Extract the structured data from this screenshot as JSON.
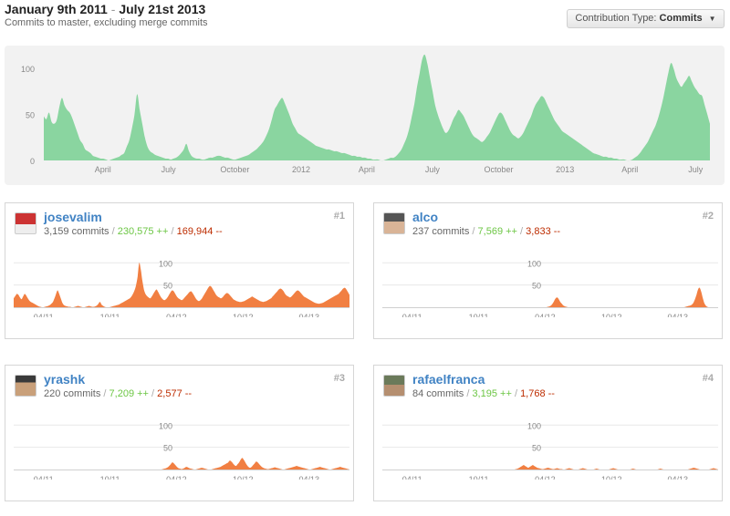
{
  "header": {
    "date_start": "January 9th 2011",
    "separator": "-",
    "date_end": "July 21st 2013",
    "subtitle": "Commits to master, excluding merge commits"
  },
  "contribution_type": {
    "label": "Contribution Type:",
    "value": "Commits",
    "icon": "caret-down-icon"
  },
  "colors": {
    "overview_fill": "#8ad5a0",
    "contributor_fill": "#f17f42"
  },
  "contributors": [
    {
      "rank": "#1",
      "name": "josevalim",
      "commits": "3,159 commits",
      "additions": "230,575 ++",
      "deletions": "169,944 --"
    },
    {
      "rank": "#2",
      "name": "alco",
      "commits": "237 commits",
      "additions": "7,569 ++",
      "deletions": "3,833 --"
    },
    {
      "rank": "#3",
      "name": "yrashk",
      "commits": "220 commits",
      "additions": "7,209 ++",
      "deletions": "2,577 --"
    },
    {
      "rank": "#4",
      "name": "rafaelfranca",
      "commits": "84 commits",
      "additions": "3,195 ++",
      "deletions": "1,768 --"
    }
  ],
  "chart_data": [
    {
      "type": "area",
      "series": "overview",
      "x_start": "2011-01-09",
      "x_end": "2013-07-21",
      "step_days": 14,
      "y_ticks": [
        0,
        50,
        100
      ],
      "ylim": [
        0,
        115
      ],
      "x_ticks": [
        {
          "label": "April",
          "date": "2011-04-01"
        },
        {
          "label": "July",
          "date": "2011-07-01"
        },
        {
          "label": "October",
          "date": "2011-10-01"
        },
        {
          "label": "2012",
          "date": "2012-01-01"
        },
        {
          "label": "April",
          "date": "2012-04-01"
        },
        {
          "label": "July",
          "date": "2012-07-01"
        },
        {
          "label": "October",
          "date": "2012-10-01"
        },
        {
          "label": "2013",
          "date": "2013-01-01"
        },
        {
          "label": "April",
          "date": "2013-04-01"
        },
        {
          "label": "July",
          "date": "2013-07-01"
        }
      ],
      "values": [
        48,
        45,
        52,
        42,
        40,
        44,
        58,
        68,
        60,
        55,
        52,
        46,
        38,
        30,
        22,
        18,
        12,
        10,
        8,
        5,
        4,
        3,
        2,
        2,
        1,
        0,
        1,
        2,
        3,
        4,
        6,
        8,
        15,
        22,
        35,
        50,
        72,
        55,
        40,
        25,
        15,
        10,
        8,
        6,
        5,
        4,
        3,
        2,
        2,
        1,
        2,
        3,
        5,
        8,
        12,
        18,
        10,
        5,
        3,
        2,
        2,
        1,
        1,
        2,
        3,
        3,
        4,
        5,
        5,
        4,
        3,
        3,
        2,
        1,
        1,
        2,
        3,
        4,
        5,
        6,
        8,
        10,
        12,
        15,
        18,
        22,
        28,
        35,
        45,
        55,
        60,
        65,
        68,
        62,
        55,
        48,
        40,
        35,
        30,
        28,
        26,
        24,
        22,
        20,
        18,
        16,
        15,
        14,
        13,
        12,
        12,
        11,
        10,
        10,
        9,
        8,
        8,
        7,
        6,
        5,
        5,
        4,
        4,
        3,
        3,
        2,
        2,
        1,
        1,
        1,
        0,
        0,
        1,
        2,
        3,
        3,
        5,
        8,
        12,
        18,
        25,
        35,
        48,
        62,
        80,
        95,
        110,
        115,
        105,
        90,
        75,
        60,
        50,
        42,
        35,
        30,
        32,
        38,
        45,
        50,
        55,
        52,
        48,
        42,
        36,
        30,
        26,
        24,
        22,
        20,
        22,
        26,
        30,
        36,
        42,
        48,
        52,
        50,
        44,
        38,
        32,
        28,
        26,
        24,
        26,
        30,
        36,
        42,
        48,
        56,
        62,
        66,
        70,
        68,
        62,
        56,
        50,
        44,
        40,
        36,
        32,
        30,
        28,
        26,
        24,
        22,
        20,
        18,
        16,
        14,
        12,
        10,
        8,
        7,
        6,
        5,
        4,
        4,
        3,
        3,
        2,
        2,
        1,
        1,
        1,
        0,
        0,
        1,
        3,
        5,
        8,
        12,
        16,
        20,
        26,
        32,
        38,
        46,
        56,
        68,
        82,
        96,
        106,
        100,
        90,
        84,
        80,
        84,
        88,
        92,
        86,
        80,
        76,
        72,
        70,
        60,
        50,
        40
      ]
    },
    {
      "type": "area",
      "series": "josevalim",
      "x_start": "2011-01-09",
      "x_end": "2013-07-21",
      "y_ticks": [
        50,
        100
      ],
      "ylim": [
        0,
        115
      ],
      "x_ticks": [
        {
          "label": "04/11",
          "date": "2011-04-01"
        },
        {
          "label": "10/11",
          "date": "2011-10-01"
        },
        {
          "label": "04/12",
          "date": "2012-04-01"
        },
        {
          "label": "10/12",
          "date": "2012-10-01"
        },
        {
          "label": "04/13",
          "date": "2013-04-01"
        }
      ],
      "values": [
        20,
        25,
        30,
        28,
        22,
        18,
        24,
        30,
        26,
        20,
        15,
        12,
        10,
        8,
        6,
        4,
        2,
        1,
        0,
        0,
        1,
        2,
        3,
        5,
        8,
        12,
        20,
        30,
        38,
        30,
        20,
        10,
        5,
        3,
        2,
        1,
        1,
        0,
        0,
        1,
        2,
        3,
        2,
        1,
        0,
        0,
        1,
        2,
        3,
        2,
        1,
        1,
        2,
        4,
        8,
        12,
        6,
        3,
        1,
        0,
        0,
        0,
        1,
        2,
        3,
        4,
        5,
        6,
        8,
        10,
        12,
        14,
        16,
        18,
        20,
        24,
        30,
        38,
        50,
        70,
        100,
        85,
        60,
        40,
        30,
        25,
        22,
        20,
        24,
        30,
        36,
        40,
        35,
        28,
        22,
        18,
        16,
        18,
        22,
        28,
        34,
        38,
        36,
        30,
        24,
        20,
        18,
        16,
        18,
        22,
        26,
        30,
        34,
        36,
        32,
        26,
        20,
        16,
        14,
        16,
        20,
        26,
        32,
        38,
        44,
        48,
        46,
        40,
        34,
        28,
        24,
        22,
        20,
        22,
        26,
        30,
        32,
        30,
        26,
        22,
        18,
        16,
        14,
        13,
        12,
        12,
        13,
        14,
        16,
        18,
        20,
        22,
        24,
        22,
        20,
        18,
        16,
        14,
        13,
        12,
        13,
        14,
        16,
        18,
        20,
        24,
        28,
        32,
        36,
        40,
        42,
        40,
        36,
        30,
        26,
        24,
        22,
        24,
        28,
        32,
        36,
        38,
        36,
        32,
        28,
        24,
        22,
        20,
        18,
        16,
        14,
        12,
        10,
        9,
        8,
        8,
        9,
        10,
        12,
        14,
        16,
        18,
        20,
        22,
        24,
        26,
        28,
        30,
        34,
        38,
        42,
        44,
        40,
        34,
        28
      ]
    },
    {
      "type": "area",
      "series": "alco",
      "x_start": "2011-01-09",
      "x_end": "2013-07-21",
      "y_ticks": [
        50,
        100
      ],
      "ylim": [
        0,
        115
      ],
      "x_ticks": [
        {
          "label": "04/11",
          "date": "2011-04-01"
        },
        {
          "label": "10/11",
          "date": "2011-10-01"
        },
        {
          "label": "04/12",
          "date": "2012-04-01"
        },
        {
          "label": "10/12",
          "date": "2012-10-01"
        },
        {
          "label": "04/13",
          "date": "2013-04-01"
        }
      ],
      "values": [
        0,
        0,
        0,
        0,
        0,
        0,
        0,
        0,
        0,
        0,
        0,
        0,
        0,
        0,
        0,
        0,
        0,
        0,
        0,
        0,
        0,
        0,
        0,
        0,
        0,
        0,
        0,
        0,
        0,
        0,
        0,
        0,
        0,
        0,
        0,
        0,
        0,
        0,
        0,
        0,
        0,
        0,
        0,
        0,
        0,
        0,
        0,
        0,
        0,
        0,
        0,
        0,
        0,
        0,
        0,
        0,
        0,
        0,
        0,
        0,
        0,
        0,
        0,
        0,
        0,
        0,
        0,
        0,
        0,
        0,
        0,
        0,
        0,
        0,
        0,
        0,
        0,
        0,
        0,
        0,
        0,
        0,
        0,
        0,
        0,
        0,
        0,
        0,
        0,
        0,
        0,
        0,
        0,
        0,
        0,
        0,
        0,
        0,
        0,
        0,
        0,
        0,
        0,
        0,
        0,
        0,
        0,
        1,
        2,
        4,
        8,
        14,
        20,
        22,
        18,
        12,
        8,
        4,
        2,
        1,
        0,
        0,
        0,
        0,
        0,
        0,
        0,
        0,
        0,
        0,
        0,
        0,
        0,
        0,
        0,
        0,
        0,
        0,
        0,
        0,
        0,
        0,
        0,
        0,
        0,
        0,
        0,
        0,
        0,
        0,
        0,
        0,
        0,
        0,
        0,
        0,
        0,
        0,
        0,
        0,
        0,
        0,
        0,
        0,
        0,
        0,
        0,
        0,
        0,
        0,
        0,
        0,
        0,
        0,
        0,
        0,
        0,
        0,
        0,
        0,
        0,
        0,
        0,
        0,
        0,
        0,
        0,
        0,
        0,
        0,
        0,
        0,
        0,
        0,
        0,
        0,
        1,
        2,
        3,
        4,
        6,
        10,
        18,
        28,
        40,
        44,
        36,
        22,
        10,
        4,
        1,
        0,
        0,
        0,
        0,
        0,
        0,
        0
      ]
    },
    {
      "type": "area",
      "series": "yrashk",
      "x_start": "2011-01-09",
      "x_end": "2013-07-21",
      "y_ticks": [
        50,
        100
      ],
      "ylim": [
        0,
        115
      ],
      "x_ticks": [
        {
          "label": "04/11",
          "date": "2011-04-01"
        },
        {
          "label": "10/11",
          "date": "2011-10-01"
        },
        {
          "label": "04/12",
          "date": "2012-04-01"
        },
        {
          "label": "10/12",
          "date": "2012-10-01"
        },
        {
          "label": "04/13",
          "date": "2013-04-01"
        }
      ],
      "values": [
        0,
        0,
        0,
        0,
        0,
        0,
        0,
        0,
        0,
        0,
        0,
        0,
        0,
        0,
        0,
        0,
        0,
        0,
        0,
        0,
        0,
        0,
        0,
        0,
        0,
        0,
        0,
        0,
        0,
        0,
        0,
        0,
        0,
        0,
        0,
        0,
        0,
        0,
        0,
        0,
        0,
        0,
        0,
        0,
        0,
        0,
        0,
        0,
        0,
        0,
        0,
        0,
        0,
        0,
        0,
        0,
        0,
        0,
        0,
        0,
        0,
        0,
        0,
        0,
        0,
        0,
        0,
        0,
        0,
        0,
        0,
        0,
        0,
        0,
        0,
        0,
        0,
        0,
        0,
        0,
        0,
        0,
        0,
        0,
        0,
        0,
        0,
        0,
        0,
        0,
        0,
        0,
        0,
        0,
        0,
        0,
        1,
        2,
        3,
        5,
        8,
        12,
        16,
        14,
        10,
        6,
        3,
        2,
        1,
        2,
        4,
        6,
        5,
        3,
        2,
        1,
        0,
        0,
        1,
        2,
        3,
        4,
        3,
        2,
        1,
        0,
        0,
        0,
        1,
        2,
        3,
        4,
        5,
        6,
        8,
        10,
        12,
        14,
        16,
        20,
        18,
        14,
        10,
        8,
        12,
        16,
        22,
        26,
        22,
        16,
        10,
        6,
        4,
        6,
        10,
        14,
        18,
        16,
        12,
        8,
        5,
        3,
        2,
        1,
        1,
        2,
        3,
        4,
        5,
        4,
        3,
        2,
        1,
        0,
        0,
        1,
        2,
        3,
        4,
        5,
        6,
        7,
        8,
        7,
        6,
        5,
        4,
        3,
        2,
        1,
        0,
        0,
        1,
        2,
        3,
        4,
        5,
        6,
        5,
        4,
        3,
        2,
        1,
        0,
        0,
        1,
        2,
        3,
        4,
        5,
        6,
        5,
        4,
        3,
        2,
        1,
        0
      ]
    },
    {
      "type": "area",
      "series": "rafaelfranca",
      "x_start": "2011-01-09",
      "x_end": "2013-07-21",
      "y_ticks": [
        50,
        100
      ],
      "ylim": [
        0,
        115
      ],
      "x_ticks": [
        {
          "label": "04/11",
          "date": "2011-04-01"
        },
        {
          "label": "10/11",
          "date": "2011-10-01"
        },
        {
          "label": "04/12",
          "date": "2012-04-01"
        },
        {
          "label": "10/12",
          "date": "2012-10-01"
        },
        {
          "label": "04/13",
          "date": "2013-04-01"
        }
      ],
      "values": [
        0,
        0,
        0,
        0,
        0,
        0,
        0,
        0,
        0,
        0,
        0,
        0,
        0,
        0,
        0,
        0,
        0,
        0,
        0,
        0,
        0,
        0,
        0,
        0,
        0,
        0,
        0,
        0,
        0,
        0,
        0,
        0,
        0,
        0,
        0,
        0,
        0,
        0,
        0,
        0,
        0,
        0,
        0,
        0,
        0,
        0,
        0,
        0,
        0,
        0,
        0,
        0,
        0,
        0,
        0,
        0,
        0,
        0,
        0,
        0,
        0,
        0,
        0,
        0,
        0,
        0,
        0,
        0,
        0,
        0,
        0,
        0,
        0,
        0,
        0,
        0,
        0,
        0,
        0,
        0,
        0,
        0,
        0,
        0,
        0,
        0,
        0,
        0,
        1,
        2,
        4,
        6,
        8,
        10,
        8,
        6,
        4,
        6,
        8,
        10,
        8,
        6,
        4,
        3,
        2,
        1,
        1,
        2,
        3,
        4,
        3,
        2,
        1,
        1,
        2,
        3,
        2,
        1,
        1,
        0,
        0,
        1,
        2,
        3,
        2,
        1,
        0,
        0,
        0,
        0,
        1,
        2,
        3,
        2,
        1,
        0,
        0,
        0,
        0,
        0,
        1,
        2,
        1,
        0,
        0,
        0,
        0,
        0,
        0,
        0,
        1,
        2,
        3,
        2,
        1,
        0,
        0,
        0,
        0,
        0,
        0,
        0,
        0,
        0,
        1,
        2,
        1,
        0,
        0,
        0,
        0,
        0,
        0,
        0,
        0,
        0,
        0,
        0,
        0,
        0,
        0,
        0,
        1,
        2,
        1,
        0,
        0,
        0,
        0,
        0,
        0,
        0,
        0,
        0,
        0,
        0,
        0,
        0,
        0,
        0,
        0,
        0,
        1,
        2,
        3,
        4,
        3,
        2,
        1,
        0,
        0,
        0,
        0,
        0,
        0,
        0,
        1,
        2,
        3,
        2,
        1,
        0
      ]
    }
  ]
}
